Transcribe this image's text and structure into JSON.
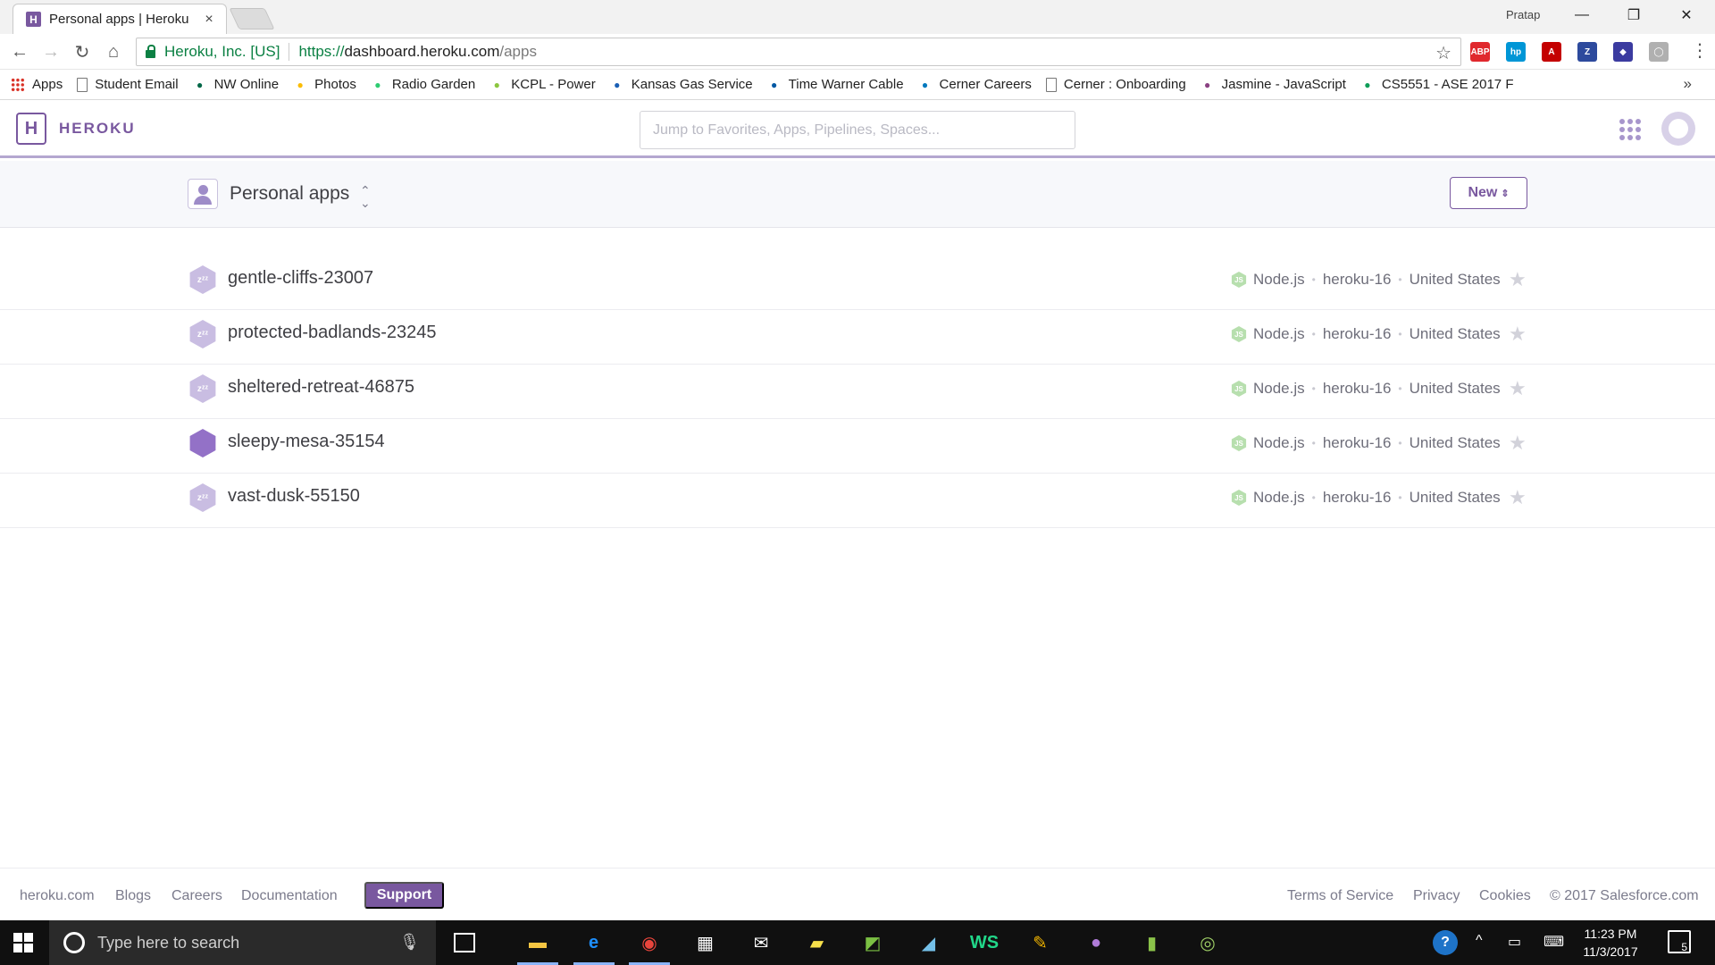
{
  "browser": {
    "tab_title": "Personal apps | Heroku",
    "tab_close": "×",
    "favicon_letter": "H",
    "profile_name": "Pratap",
    "window_controls": {
      "minimize": "—",
      "restore": "❐",
      "close": "✕"
    },
    "nav": {
      "back": "←",
      "forward": "→",
      "reload": "↻",
      "home": "⌂"
    },
    "address": {
      "org": "Heroku, Inc. [US]",
      "scheme": "https://",
      "host": "dashboard.heroku.com",
      "path": "/apps"
    },
    "bookmark_star": "☆",
    "menu": "⋮",
    "extensions": [
      {
        "name": "adblock-plus-icon",
        "label": "ABP",
        "color": "#e0282d"
      },
      {
        "name": "hp-icon",
        "label": "hp",
        "color": "#0096d6"
      },
      {
        "name": "acrobat-icon",
        "label": "A",
        "color": "#c40000"
      },
      {
        "name": "zotero-icon",
        "label": "Z",
        "color": "#2d4a9d"
      },
      {
        "name": "extension-icon",
        "label": "◆",
        "color": "#3b3ba0"
      },
      {
        "name": "extension-blank-icon",
        "label": "◯",
        "color": "#b0b0b0"
      }
    ],
    "bookmarks": [
      {
        "label": "Apps",
        "icon": "apps-grid-icon",
        "color": "#d93025"
      },
      {
        "label": "Student Email",
        "icon": "page-icon",
        "color": "#777777"
      },
      {
        "label": "NW Online",
        "icon": "nw-icon",
        "color": "#006747"
      },
      {
        "label": "Photos",
        "icon": "photos-icon",
        "color": "#fbbc04"
      },
      {
        "label": "Radio Garden",
        "icon": "radio-garden-icon",
        "color": "#2ecc71"
      },
      {
        "label": "KCPL - Power",
        "icon": "kcpl-icon",
        "color": "#8cc63f"
      },
      {
        "label": "Kansas Gas Service",
        "icon": "kgs-icon",
        "color": "#1a5fb4"
      },
      {
        "label": "Time Warner Cable",
        "icon": "twc-icon",
        "color": "#0058a3"
      },
      {
        "label": "Cerner Careers",
        "icon": "cerner-icon",
        "color": "#0079be"
      },
      {
        "label": "Cerner : Onboarding",
        "icon": "page-icon",
        "color": "#777777"
      },
      {
        "label": "Jasmine - JavaScript",
        "icon": "jasmine-icon",
        "color": "#8a4182"
      },
      {
        "label": "CS5551 - ASE 2017 F",
        "icon": "sheets-icon",
        "color": "#0f9d58"
      }
    ],
    "bookmarks_more": "»"
  },
  "heroku": {
    "logo_letter": "H",
    "logo_text": "HEROKU",
    "search_placeholder": "Jump to Favorites, Apps, Pipelines, Spaces...",
    "context": {
      "label": "Personal apps",
      "caret": "⌃⌄"
    },
    "new_button": "New",
    "new_caret": "⇕",
    "apps": [
      {
        "name": "gentle-cliffs-23007",
        "state": "sleeping",
        "language": "Node.js",
        "stack": "heroku-16",
        "region": "United States"
      },
      {
        "name": "protected-badlands-23245",
        "state": "sleeping",
        "language": "Node.js",
        "stack": "heroku-16",
        "region": "United States"
      },
      {
        "name": "sheltered-retreat-46875",
        "state": "sleeping",
        "language": "Node.js",
        "stack": "heroku-16",
        "region": "United States"
      },
      {
        "name": "sleepy-mesa-35154",
        "state": "awake",
        "language": "Node.js",
        "stack": "heroku-16",
        "region": "United States"
      },
      {
        "name": "vast-dusk-55150",
        "state": "sleeping",
        "language": "Node.js",
        "stack": "heroku-16",
        "region": "United States"
      }
    ],
    "footer": {
      "left": [
        "heroku.com",
        "Blogs",
        "Careers",
        "Documentation"
      ],
      "support": "Support",
      "right": [
        "Terms of Service",
        "Privacy",
        "Cookies",
        "© 2017 Salesforce.com"
      ]
    },
    "colors": {
      "brand": "#79589f",
      "sleep_hex": "#c9bde2",
      "awake_hex": "#9371c7"
    }
  },
  "taskbar": {
    "search_placeholder": "Type here to search",
    "clock_time": "11:23 PM",
    "clock_date": "11/3/2017",
    "notification_count": "5",
    "help": "?",
    "chevron": "^",
    "apps": [
      {
        "name": "file-explorer-icon",
        "glyph": "▬",
        "color": "#f5c542"
      },
      {
        "name": "edge-icon",
        "glyph": "e",
        "color": "#1e90ff"
      },
      {
        "name": "chrome-icon",
        "glyph": "◉",
        "color": "#e8453c"
      },
      {
        "name": "store-icon",
        "glyph": "▦",
        "color": "#ffffff"
      },
      {
        "name": "mail-icon",
        "glyph": "✉",
        "color": "#ffffff"
      },
      {
        "name": "sticky-notes-icon",
        "glyph": "▰",
        "color": "#f7e04b"
      },
      {
        "name": "visio-icon",
        "glyph": "◩",
        "color": "#7bc043"
      },
      {
        "name": "azure-icon",
        "glyph": "◢",
        "color": "#74c0e8"
      },
      {
        "name": "webstorm-icon",
        "glyph": "WS",
        "color": "#21d789"
      },
      {
        "name": "paint-icon",
        "glyph": "✎",
        "color": "#f0b400"
      },
      {
        "name": "github-icon",
        "glyph": "●",
        "color": "#b07cd8"
      },
      {
        "name": "green-app-icon",
        "glyph": "▮",
        "color": "#8bc34a"
      },
      {
        "name": "android-icon",
        "glyph": "◎",
        "color": "#9ccc65"
      }
    ]
  }
}
